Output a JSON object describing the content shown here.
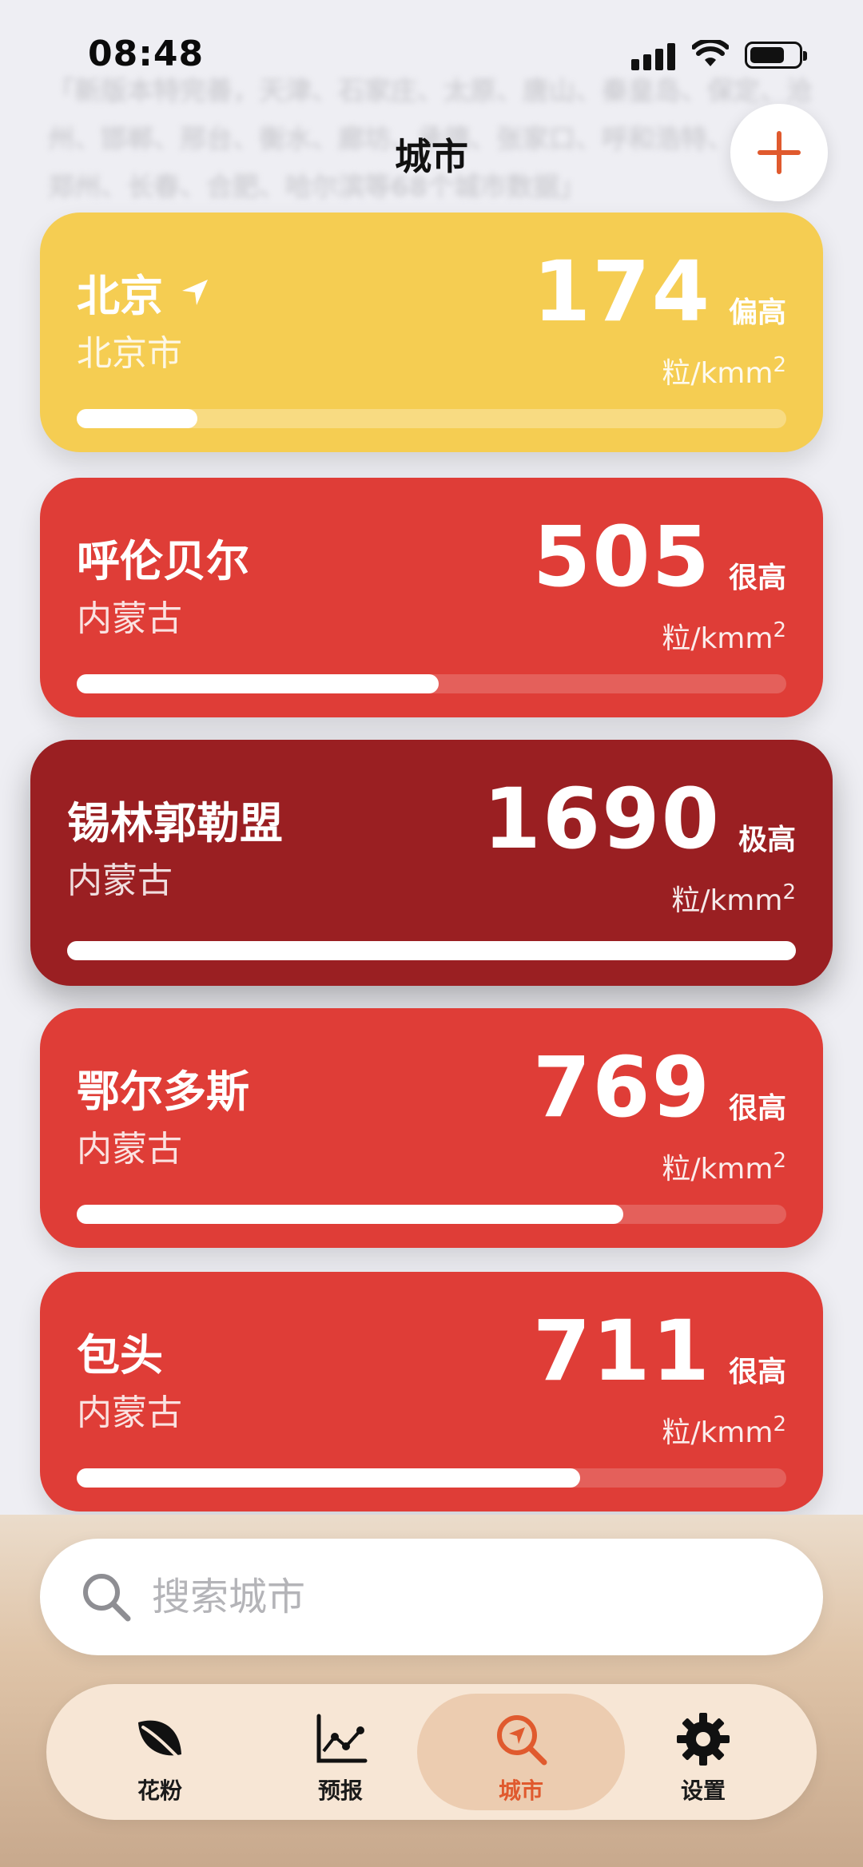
{
  "status_bar": {
    "time": "08:48"
  },
  "background_info": "「新版本特完善，天津、石家庄、太原、唐山、秦皇岛、保定、沧州、邯郸、邢台、衡水、廊坊、承德、张家口、呼和浩特、包头、郑州、长春、合肥、哈尔滨等68个城市数据」",
  "header": {
    "title": "城市"
  },
  "colors": {
    "accent": "#e05a2e",
    "level_medium": "#f5cd52",
    "level_very_high": "#df3d37",
    "level_extreme": "#9a1f22"
  },
  "cards": [
    {
      "city": "北京",
      "region": "北京市",
      "value": "174",
      "level": "偏高",
      "unit": "粒/kmm",
      "unit_sup": "2",
      "fill": 0.17,
      "located": true
    },
    {
      "city": "呼伦贝尔",
      "region": "内蒙古",
      "value": "505",
      "level": "很高",
      "unit": "粒/kmm",
      "unit_sup": "2",
      "fill": 0.51
    },
    {
      "city": "锡林郭勒盟",
      "region": "内蒙古",
      "value": "1690",
      "level": "极高",
      "unit": "粒/kmm",
      "unit_sup": "2",
      "fill": 1.0
    },
    {
      "city": "鄂尔多斯",
      "region": "内蒙古",
      "value": "769",
      "level": "很高",
      "unit": "粒/kmm",
      "unit_sup": "2",
      "fill": 0.77
    },
    {
      "city": "包头",
      "region": "内蒙古",
      "value": "711",
      "level": "很高",
      "unit": "粒/kmm",
      "unit_sup": "2",
      "fill": 0.71
    }
  ],
  "search": {
    "placeholder": "搜索城市",
    "value": ""
  },
  "tabs": [
    {
      "label": "花粉",
      "icon": "leaf-icon"
    },
    {
      "label": "预报",
      "icon": "chart-line-icon"
    },
    {
      "label": "城市",
      "icon": "location-search-icon",
      "selected": true
    },
    {
      "label": "设置",
      "icon": "gear-icon"
    }
  ]
}
